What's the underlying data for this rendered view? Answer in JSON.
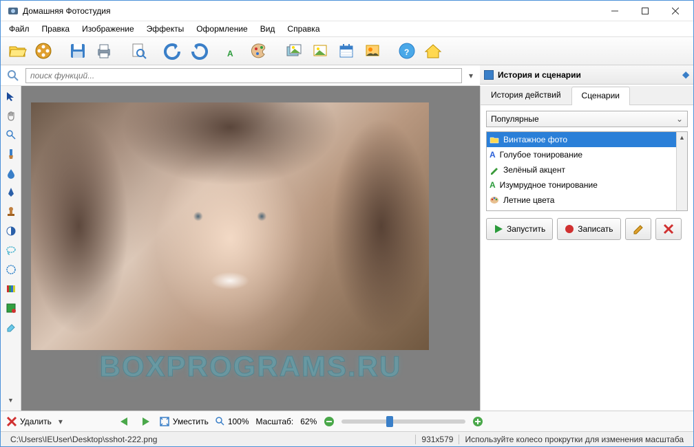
{
  "window": {
    "title": "Домашняя Фотостудия"
  },
  "menu": {
    "file": "Файл",
    "edit": "Правка",
    "image": "Изображение",
    "effects": "Эффекты",
    "decoration": "Оформление",
    "view": "Вид",
    "help": "Справка"
  },
  "search": {
    "placeholder": "поиск функций..."
  },
  "right_panel": {
    "title": "История и сценарии",
    "tab_history": "История действий",
    "tab_scenarios": "Сценарии",
    "dropdown_selected": "Популярные",
    "scenarios": [
      {
        "label": "Винтажное фото",
        "icon": "folder"
      },
      {
        "label": "Голубое тонирование",
        "icon": "letter-a-blue"
      },
      {
        "label": "Зелёный акцент",
        "icon": "pencil-green"
      },
      {
        "label": "Изумрудное тонирование",
        "icon": "letter-a-green"
      },
      {
        "label": "Летние цвета",
        "icon": "palette"
      }
    ],
    "btn_run": "Запустить",
    "btn_record": "Записать"
  },
  "bottom": {
    "btn_delete": "Удалить",
    "btn_fit": "Уместить",
    "zoom_fixed": "100%",
    "zoom_label": "Масштаб:",
    "zoom_value": "62%"
  },
  "status": {
    "path": "C:\\Users\\IEUser\\Desktop\\sshot-222.png",
    "dimensions": "931x579",
    "hint": "Используйте колесо прокрутки для изменения масштаба"
  },
  "watermark": "BOXPROGRAMS.RU"
}
